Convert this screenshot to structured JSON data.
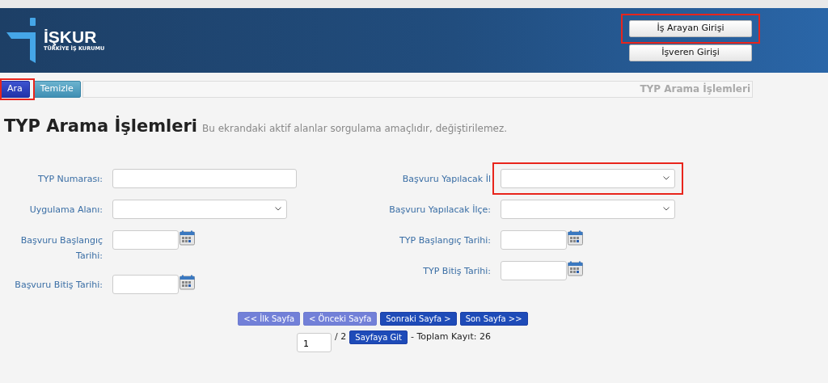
{
  "header": {
    "logo": {
      "name": "İŞKUR",
      "subtitle": "TÜRKİYE İŞ KURUMU"
    },
    "login_buttons": [
      {
        "label": "İş Arayan Girişi",
        "annotation": {
          "kind": "highlight-box"
        }
      },
      {
        "label": "İşveren Girişi"
      }
    ]
  },
  "toolbar": {
    "buttons": [
      {
        "label": "Ara",
        "kind": "primary",
        "annotation": {
          "kind": "highlight-box"
        }
      },
      {
        "label": "Temizle",
        "kind": "secondary"
      }
    ],
    "title": "TYP Arama İşlemleri"
  },
  "page": {
    "title": "TYP Arama İşlemleri",
    "subtitle": "Bu ekrandaki aktif alanlar sorgulama amaçlıdır, değiştirilemez."
  },
  "form": {
    "left": [
      {
        "label": "TYP Numarası:",
        "kind": "text"
      },
      {
        "label": "Uygulama Alanı:",
        "kind": "select"
      },
      {
        "label": "Başvuru Başlangıç Tarihi:",
        "kind": "date"
      },
      {
        "label": "Başvuru Bitiş Tarihi:",
        "kind": "date"
      }
    ],
    "right": [
      {
        "label": "Başvuru Yapılacak İl",
        "kind": "select",
        "annotation": {
          "kind": "highlight-box"
        }
      },
      {
        "label": "Başvuru Yapılacak İlçe:",
        "kind": "select"
      },
      {
        "label": "TYP Başlangıç Tarihi:",
        "kind": "date"
      },
      {
        "label": "TYP Bitiş Tarihi:",
        "kind": "date"
      }
    ]
  },
  "pager": {
    "buttons": [
      {
        "label": "<< İlk Sayfa",
        "disabled": true
      },
      {
        "label": "< Önceki Sayfa",
        "disabled": true
      },
      {
        "label": "Sonraki Sayfa >",
        "disabled": false
      },
      {
        "label": "Son Sayfa >>",
        "disabled": false
      }
    ],
    "page_value": "1",
    "page_total": "/ 2",
    "go_button": "Sayfaya Git",
    "record_count": "- Toplam Kayıt: 26"
  }
}
